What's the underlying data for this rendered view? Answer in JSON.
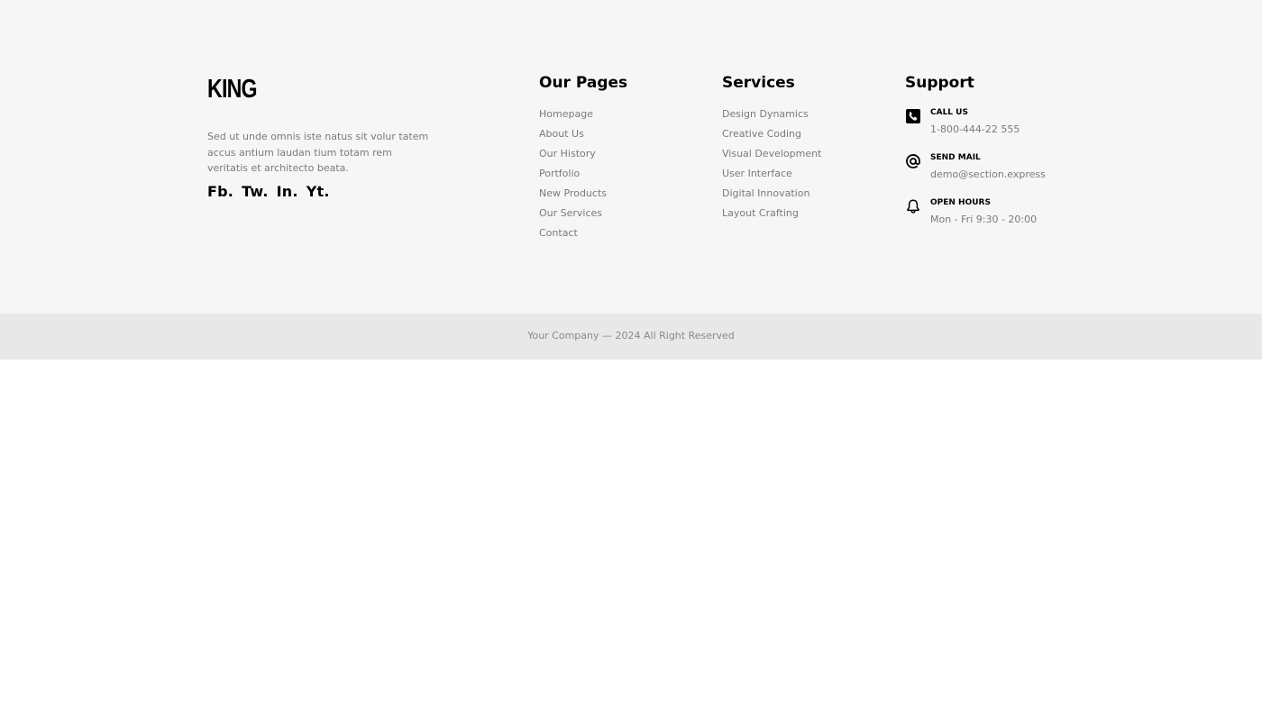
{
  "brand": {
    "logo": "KING",
    "about": "Sed ut unde omnis iste natus sit volur tatem accus antium laudan tium totam rem veritatis et architecto beata.",
    "socials": [
      "Fb.",
      "Tw.",
      "In.",
      "Yt."
    ]
  },
  "pages": {
    "title": "Our Pages",
    "links": [
      "Homepage",
      "About Us",
      "Our History",
      "Portfolio",
      "New Products",
      "Our Services",
      "Contact"
    ]
  },
  "services": {
    "title": "Services",
    "links": [
      "Design Dynamics",
      "Creative Coding",
      "Visual Development",
      "User Interface",
      "Digital Innovation",
      "Layout Crafting"
    ]
  },
  "support": {
    "title": "Support",
    "items": [
      {
        "icon": "phone-icon",
        "label": "CALL US",
        "value": "1-800-444-22 555"
      },
      {
        "icon": "at-icon",
        "label": "SEND MAIL",
        "value": "demo@section.express"
      },
      {
        "icon": "bell-icon",
        "label": "OPEN HOURS",
        "value": "Mon - Fri 9:30 - 20:00"
      }
    ]
  },
  "copyright": "Your Company — 2024 All Right Reserved",
  "colors": {
    "footer_bg": "#f6f6f6",
    "bottom_bar_bg": "#e8e8e8",
    "text_muted": "#7a7a7a",
    "text_dark": "#000000"
  }
}
